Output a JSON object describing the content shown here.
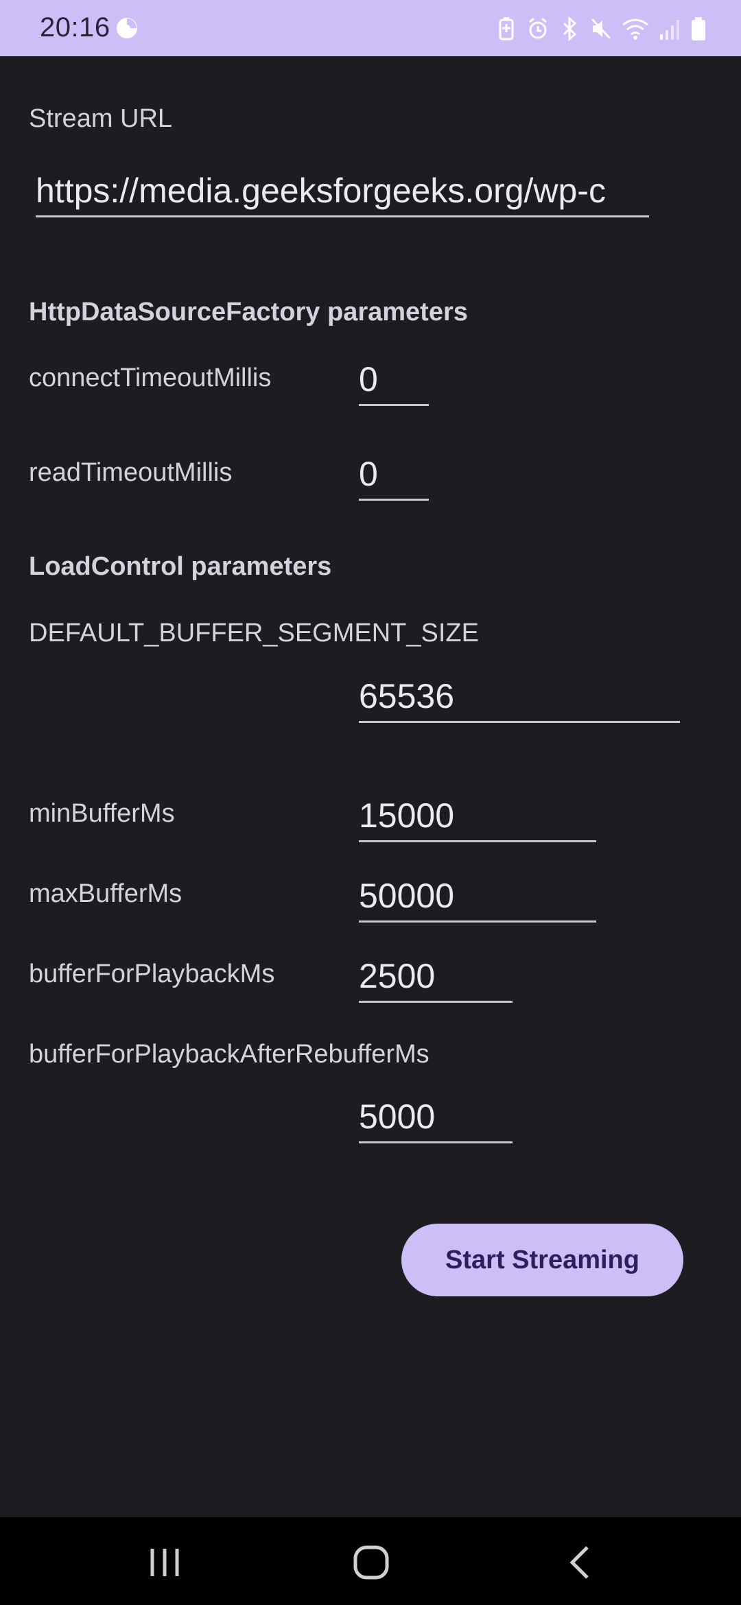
{
  "status_bar": {
    "time": "20:16",
    "icons": [
      "app-notification-icon",
      "battery-saver-icon",
      "alarm-icon",
      "bluetooth-icon",
      "mute-icon",
      "wifi-icon",
      "signal-icon",
      "battery-icon"
    ]
  },
  "stream": {
    "label": "Stream URL",
    "url": "https://media.geeksforgeeks.org/wp-c"
  },
  "http_section": {
    "heading": "HttpDataSourceFactory parameters",
    "connect_timeout_label": "connectTimeoutMillis",
    "connect_timeout_value": "0",
    "read_timeout_label": "readTimeoutMillis",
    "read_timeout_value": "0"
  },
  "load_control_section": {
    "heading": "LoadControl parameters",
    "segment_size_label": "DEFAULT_BUFFER_SEGMENT_SIZE",
    "segment_size_value": "65536",
    "min_buffer_label": "minBufferMs",
    "min_buffer_value": "15000",
    "max_buffer_label": "maxBufferMs",
    "max_buffer_value": "50000",
    "playback_buffer_label": "bufferForPlaybackMs",
    "playback_buffer_value": "2500",
    "rebuffer_label": "bufferForPlaybackAfterRebufferMs",
    "rebuffer_value": "5000"
  },
  "actions": {
    "start_label": "Start Streaming"
  },
  "colors": {
    "accent": "#cdbef8",
    "background": "#1d1c21",
    "button_text": "#2d1f5c"
  }
}
